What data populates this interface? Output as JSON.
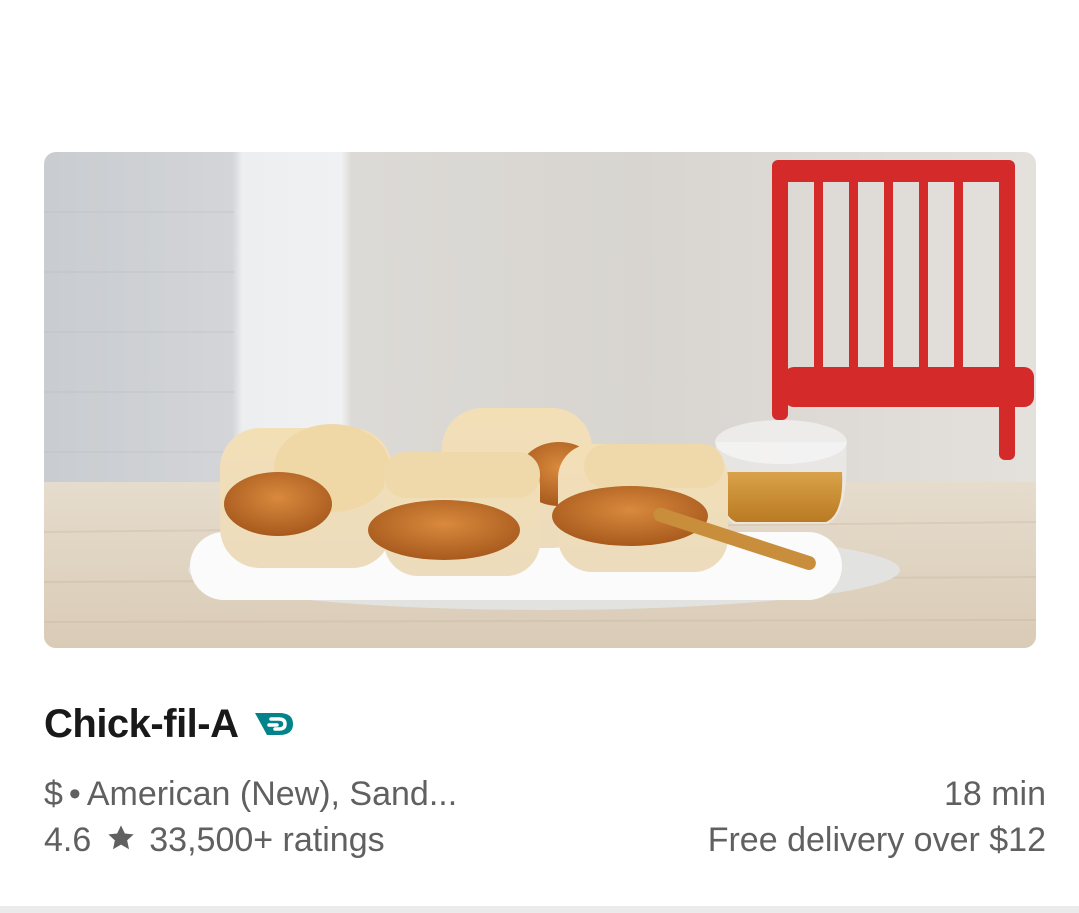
{
  "store": {
    "name": "Chick-fil-A",
    "dashpass_icon": "dashpass-icon",
    "hero_image": "chicken-biscuit-platter-photo",
    "price_range": "$",
    "separator": "•",
    "cuisines": "American (New), Sand...",
    "rating": "4.6",
    "rating_icon": "star-icon",
    "ratings_count": "33,500+ ratings",
    "eta": "18 min",
    "delivery_fee": "Free delivery over $12"
  },
  "colors": {
    "dashpass_teal": "#00838A",
    "text_primary": "#191919",
    "text_secondary": "#606060",
    "divider": "#EBEBEB"
  }
}
